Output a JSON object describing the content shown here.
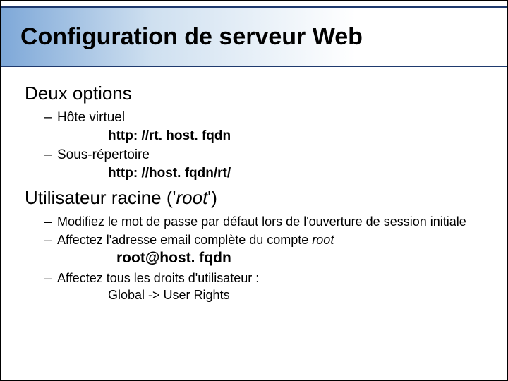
{
  "title": "Configuration de serveur Web",
  "section1": {
    "heading": "Deux options",
    "item1": {
      "label": "Hôte virtuel",
      "detail": "http: //rt. host. fqdn"
    },
    "item2": {
      "label": "Sous-répertoire",
      "detail": "http: //host. fqdn/rt/"
    }
  },
  "section2": {
    "heading_prefix": "Utilisateur racine ('",
    "heading_root": "root",
    "heading_suffix": "')",
    "item1": "Modifiez le mot de passe par défaut lors de l'ouverture de session initiale",
    "item2_prefix": "Affectez l'adresse email complète du compte ",
    "item2_root": "root",
    "email": "root@host. fqdn",
    "item3": {
      "label": "Affectez tous les droits d'utilisateur :",
      "detail": "Global -> User Rights"
    }
  }
}
